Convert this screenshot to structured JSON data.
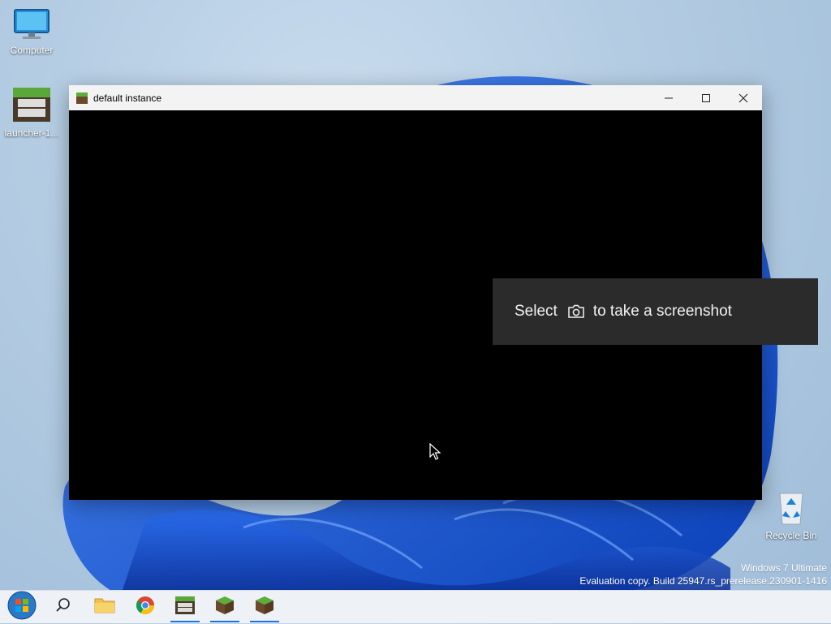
{
  "desktop": {
    "icons": [
      {
        "label": "Computer",
        "icon": "monitor-icon"
      },
      {
        "label": "launcher-1...",
        "icon": "betacraft-icon"
      },
      {
        "label": "Recycle Bin",
        "icon": "recycle-bin-icon"
      }
    ],
    "watermark": {
      "line1": "Windows 7 Ultimate",
      "line2": "Evaluation copy. Build 25947.rs_prerelease.230901-1416"
    }
  },
  "window": {
    "title": "default instance",
    "icon": "grass-block-icon",
    "controls": [
      "minimize",
      "maximize",
      "close"
    ]
  },
  "toast": {
    "before": "Select",
    "icon": "camera-icon",
    "after": "to take a screenshot"
  },
  "taskbar": {
    "items": [
      {
        "name": "start",
        "icon": "windows-orb-icon",
        "active": false
      },
      {
        "name": "search",
        "icon": "search-icon",
        "active": false
      },
      {
        "name": "file-explorer",
        "icon": "folder-icon",
        "active": false
      },
      {
        "name": "chrome",
        "icon": "chrome-icon",
        "active": false
      },
      {
        "name": "betacraft",
        "icon": "betacraft-icon",
        "active": true
      },
      {
        "name": "minecraft-1",
        "icon": "grass-block-icon",
        "active": true
      },
      {
        "name": "minecraft-2",
        "icon": "grass-block-icon",
        "active": true
      }
    ]
  },
  "colors": {
    "accent": "#1a73e8",
    "toast_bg": "#2b2b2b",
    "titlebar_bg": "#f3f3f3"
  }
}
